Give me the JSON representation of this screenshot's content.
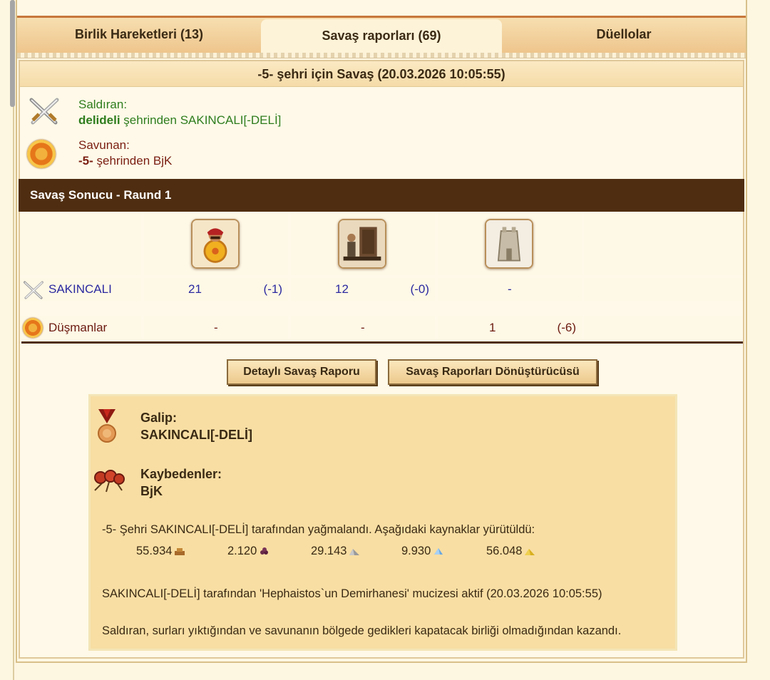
{
  "tabs": [
    {
      "label": "Birlik Hareketleri (13)"
    },
    {
      "label": "Savaş raporları (69)"
    },
    {
      "label": "Düellolar"
    }
  ],
  "report": {
    "title": "-5- şehri için Savaş (20.03.2026 10:05:55)",
    "attacker": {
      "label": "Saldıran:",
      "city": "delideli",
      "city_suffix": " şehrinden SAKINCALI[-DELİ]"
    },
    "defender": {
      "label": "Savunan:",
      "city": "-5-",
      "city_suffix": " şehrinden BjK"
    },
    "result_title": "Savaş Sonucu - Raund 1"
  },
  "units": [
    "hoplite-unit-icon",
    "catapult-unit-icon",
    "wall-unit-icon"
  ],
  "rows": [
    {
      "name": "SAKINCALI",
      "cells": [
        {
          "count": "21",
          "loss": "(-1)"
        },
        {
          "count": "12",
          "loss": "(-0)"
        },
        {
          "count": "-",
          "loss": ""
        }
      ]
    },
    {
      "name": "Düşmanlar",
      "cells": [
        {
          "count": "-",
          "loss": ""
        },
        {
          "count": "-",
          "loss": ""
        },
        {
          "count": "1",
          "loss": "(-6)"
        }
      ]
    }
  ],
  "buttons": {
    "detail": "Detaylı Savaş Raporu",
    "converter": "Savaş Raporları Dönüştürücüsü"
  },
  "summary": {
    "winner_label": "Galip:",
    "winner": "SAKINCALI[-DELİ]",
    "losers_label": "Kaybedenler:",
    "losers": "BjK",
    "plunder_text": "-5- Şehri SAKINCALI[-DELİ] tarafından yağmalandı. Aşağıdaki kaynaklar yürütüldü:",
    "resources": [
      {
        "value": "55.934",
        "icon": "wood-icon"
      },
      {
        "value": "2.120",
        "icon": "wine-icon"
      },
      {
        "value": "29.143",
        "icon": "marble-icon"
      },
      {
        "value": "9.930",
        "icon": "crystal-icon"
      },
      {
        "value": "56.048",
        "icon": "sulfur-icon"
      }
    ],
    "wonder_text": "SAKINCALI[-DELİ] tarafından 'Hephaistos`un Demirhanesi' mucizesi aktif (20.03.2026 10:05:55)",
    "reason_text": "Saldıran, surları yıktığından ve savunanın bölgede gedikleri kapatacak birliği olmadığından kazandı."
  },
  "colors": {
    "dark_bar": "#4f2d10",
    "attacker": "#2e7d1e",
    "defender": "#7a1e12",
    "link_blue": "#2b2aa0"
  }
}
